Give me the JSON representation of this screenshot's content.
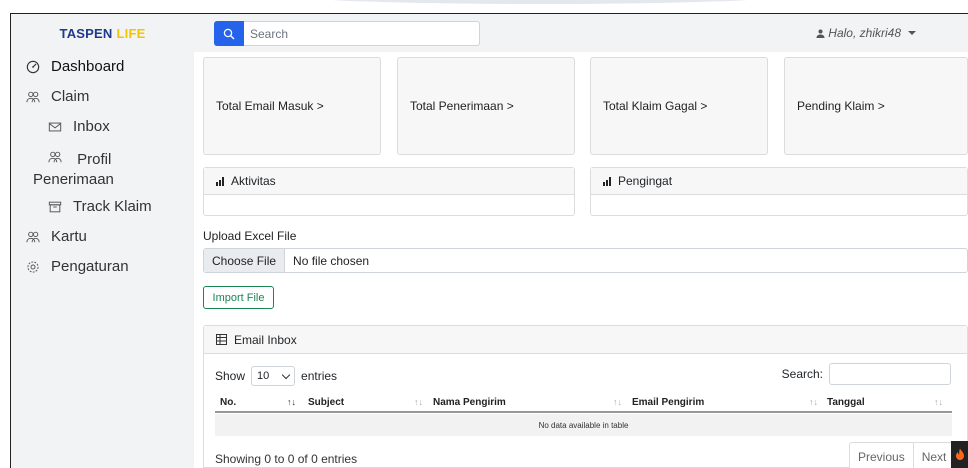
{
  "brand": {
    "part1": "TASPEN",
    "part2": "LIFE"
  },
  "search": {
    "placeholder": "Search"
  },
  "user": {
    "greeting": "Halo, zhikri48"
  },
  "sidebar": {
    "items": [
      {
        "label": "Dashboard",
        "icon": "dashboard-icon"
      },
      {
        "label": "Claim",
        "icon": "users-icon"
      },
      {
        "label": "Inbox",
        "icon": "mail-icon"
      },
      {
        "label": "Profil Penerimaan",
        "icon": "users-icon"
      },
      {
        "label": "Track Klaim",
        "icon": "archive-icon"
      },
      {
        "label": "Kartu",
        "icon": "users-icon"
      },
      {
        "label": "Pengaturan",
        "icon": "gear-icon"
      }
    ]
  },
  "cards": [
    {
      "label": "Total Email Masuk"
    },
    {
      "label": "Total Penerimaan"
    },
    {
      "label": "Total Klaim Gagal"
    },
    {
      "label": "Pending Klaim"
    }
  ],
  "card_arrow": ">",
  "panels": {
    "aktivitas": "Aktivitas",
    "pengingat": "Pengingat"
  },
  "upload": {
    "label": "Upload Excel File",
    "choose": "Choose File",
    "status": "No file chosen",
    "import": "Import File"
  },
  "inbox": {
    "title": "Email Inbox",
    "show": "Show",
    "entries_value": "10",
    "entries": "entries",
    "search_label": "Search:",
    "columns": [
      "No.",
      "Subject",
      "Nama Pengirim",
      "Email Pengirim",
      "Tanggal"
    ],
    "empty": "No data available in table",
    "info": "Showing 0 to 0 of 0 entries",
    "prev": "Previous",
    "next": "Next"
  }
}
